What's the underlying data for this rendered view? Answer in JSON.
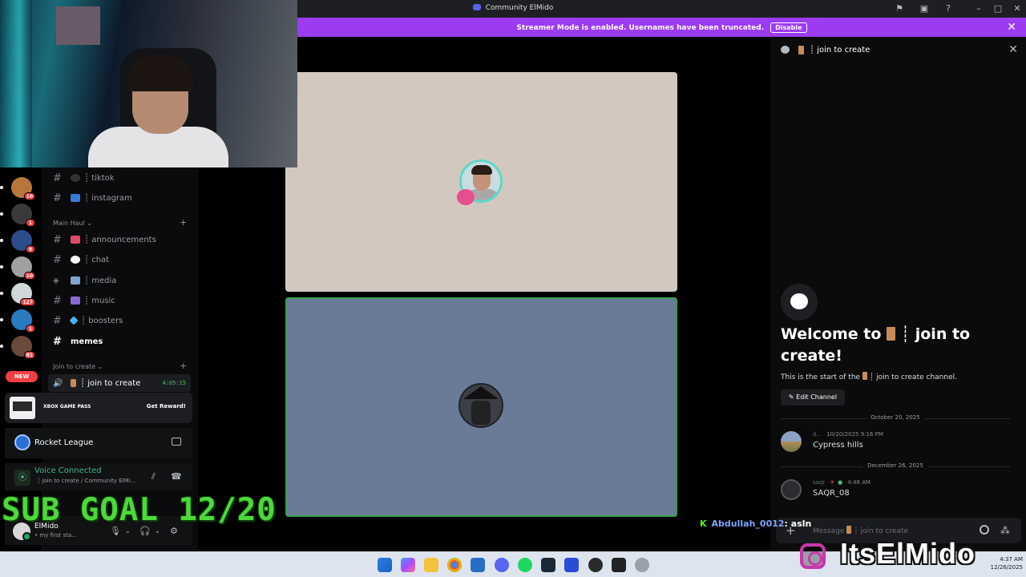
{
  "window": {
    "title": "Community ElMido"
  },
  "banner": {
    "text": "Streamer Mode is enabled. Usernames have been truncated.",
    "disable_label": "Disable"
  },
  "servers": [
    {
      "badge": "10",
      "color": "#b8763a"
    },
    {
      "badge": "1",
      "color": "#3a3a3a"
    },
    {
      "badge": "8",
      "color": "#2d4d8a"
    },
    {
      "badge": "10",
      "color": "#a0a0a0"
    },
    {
      "badge": "127",
      "color": "#cfd8d8"
    },
    {
      "badge": "1",
      "color": "#2a7ac0"
    },
    {
      "badge": "81",
      "color": "#6b4a3a"
    }
  ],
  "new_label": "NEW",
  "channels": {
    "top": [
      {
        "name": "┊ tiktok",
        "emoji_color": "#333"
      },
      {
        "name": "┊ instagram",
        "emoji_color": "#3a7bd5"
      }
    ],
    "main_category": "Main Haul",
    "main": [
      {
        "name": "┊ announcements",
        "emoji_color": "#e04a6a"
      },
      {
        "name": "┊ chat",
        "emoji_color": "#ffffff"
      },
      {
        "name": "┊ media",
        "emoji_color": "#7fa6c8"
      },
      {
        "name": "┊ music",
        "emoji_color": "#8a6ad0"
      },
      {
        "name": "┊ boosters",
        "emoji_color": "#4ab0e8"
      },
      {
        "name": "memes",
        "emoji_color": ""
      }
    ],
    "voice_category": "Join to create",
    "voice_channel": {
      "name": "┊ join to create",
      "timer": "4:05:15"
    }
  },
  "gamepass": {
    "label": "XBOX GAME PASS",
    "cta": "Get Reward!"
  },
  "activity": {
    "name": "Rocket League"
  },
  "voice": {
    "status": "Voice Connected",
    "location": "┊ join to create / Community ElMi..."
  },
  "overlay": {
    "sub_goal": "SUB GOAL 12/20",
    "chat_k": "K",
    "chat_user": "Abdullah_0012",
    "chat_message": ": asln",
    "handle": "ItsElMido"
  },
  "user": {
    "name": "ElMido",
    "status": "• my first sta..."
  },
  "chat": {
    "header": "┊ join to create",
    "welcome_prefix": "Welcome to",
    "welcome_channel": "┊ join to create!",
    "start_prefix": "This is the start of the",
    "start_channel": "┊ join to create channel.",
    "edit_label": "Edit Channel",
    "dividers": [
      "October 20, 2025",
      "December 26, 2025"
    ],
    "messages": [
      {
        "author": "d...",
        "time": "10/20/2025 9:16 PM",
        "text": "Cypress hills",
        "avatar_color": "#7a8b6a"
      },
      {
        "author": "saqr",
        "time": "4:48 AM",
        "text": "SAQR_08",
        "avatar_color": "#2a2c30"
      }
    ],
    "composer_prefix": "Message",
    "composer_channel": "┊ join to create"
  },
  "clock": {
    "time": "4:37 AM",
    "date": "12/26/2025"
  }
}
